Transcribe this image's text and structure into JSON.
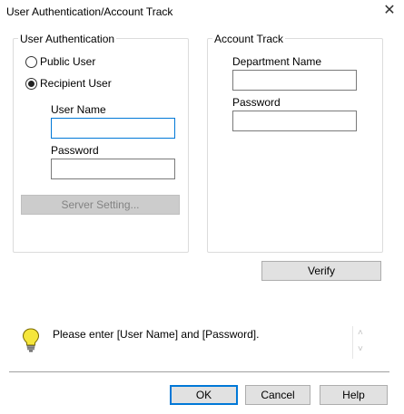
{
  "window": {
    "title": "User Authentication/Account Track",
    "close_glyph": "✕"
  },
  "user_auth": {
    "group_label": "User Authentication",
    "public_user_label": "Public User",
    "recipient_user_label": "Recipient User",
    "selected": "recipient_user",
    "user_name_label": "User Name",
    "user_name_value": "",
    "password_label": "Password",
    "password_value": "",
    "server_setting_label": "Server Setting..."
  },
  "account_track": {
    "group_label": "Account Track",
    "department_name_label": "Department Name",
    "department_name_value": "",
    "password_label": "Password",
    "password_value": "",
    "verify_label": "Verify"
  },
  "message": {
    "icon": "lightbulb-icon",
    "text": "Please enter [User Name] and [Password].",
    "scroll_up": "˄",
    "scroll_down": "˅"
  },
  "buttons": {
    "ok": "OK",
    "cancel": "Cancel",
    "help": "Help"
  },
  "colors": {
    "focus_border": "#0078d7",
    "bulb": "#f5e63c"
  }
}
